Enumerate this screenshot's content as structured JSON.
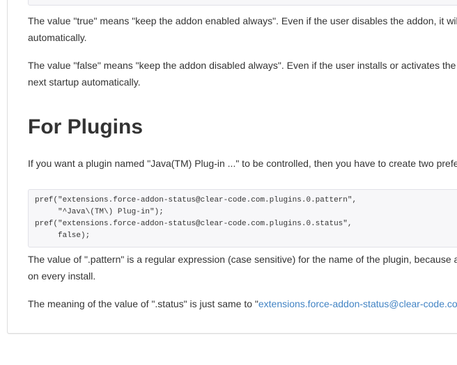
{
  "paragraphs": {
    "true_value": "The value \"true\" means \"keep the addon enabled always\". Even if the user disables the addon, it will",
    "true_value_cont": "automatically.",
    "false_value": "The value \"false\" means \"keep the addon disabled always\". Even if the user installs or activates the",
    "false_value_cont": "next startup automatically.",
    "plugin_intro": "If you want a plugin named \"Java(TM) Plug-in ...\" to be controlled, then you have to create two prefer",
    "pattern_desc": "The value of \".pattern\" is a regular expression (case sensitive) for the name of the plugin, because a",
    "pattern_desc_cont": "on every install.",
    "status_desc_prefix": "The meaning of the value of \".status\" is just same to \"",
    "status_desc_link": "extensions.force-addon-status@clear-code.co"
  },
  "heading": {
    "for_plugins": "For Plugins"
  },
  "code": {
    "line1": "pref(\"extensions.force-addon-status@clear-code.com.plugins.0.pattern\",",
    "line2": "     \"^Java\\(TM\\) Plug-in\");",
    "line3": "pref(\"extensions.force-addon-status@clear-code.com.plugins.0.status\",",
    "line4": "     false);"
  },
  "colors": {
    "link": "#4183c4",
    "text": "#333333",
    "code_bg": "#f7f7f9"
  }
}
